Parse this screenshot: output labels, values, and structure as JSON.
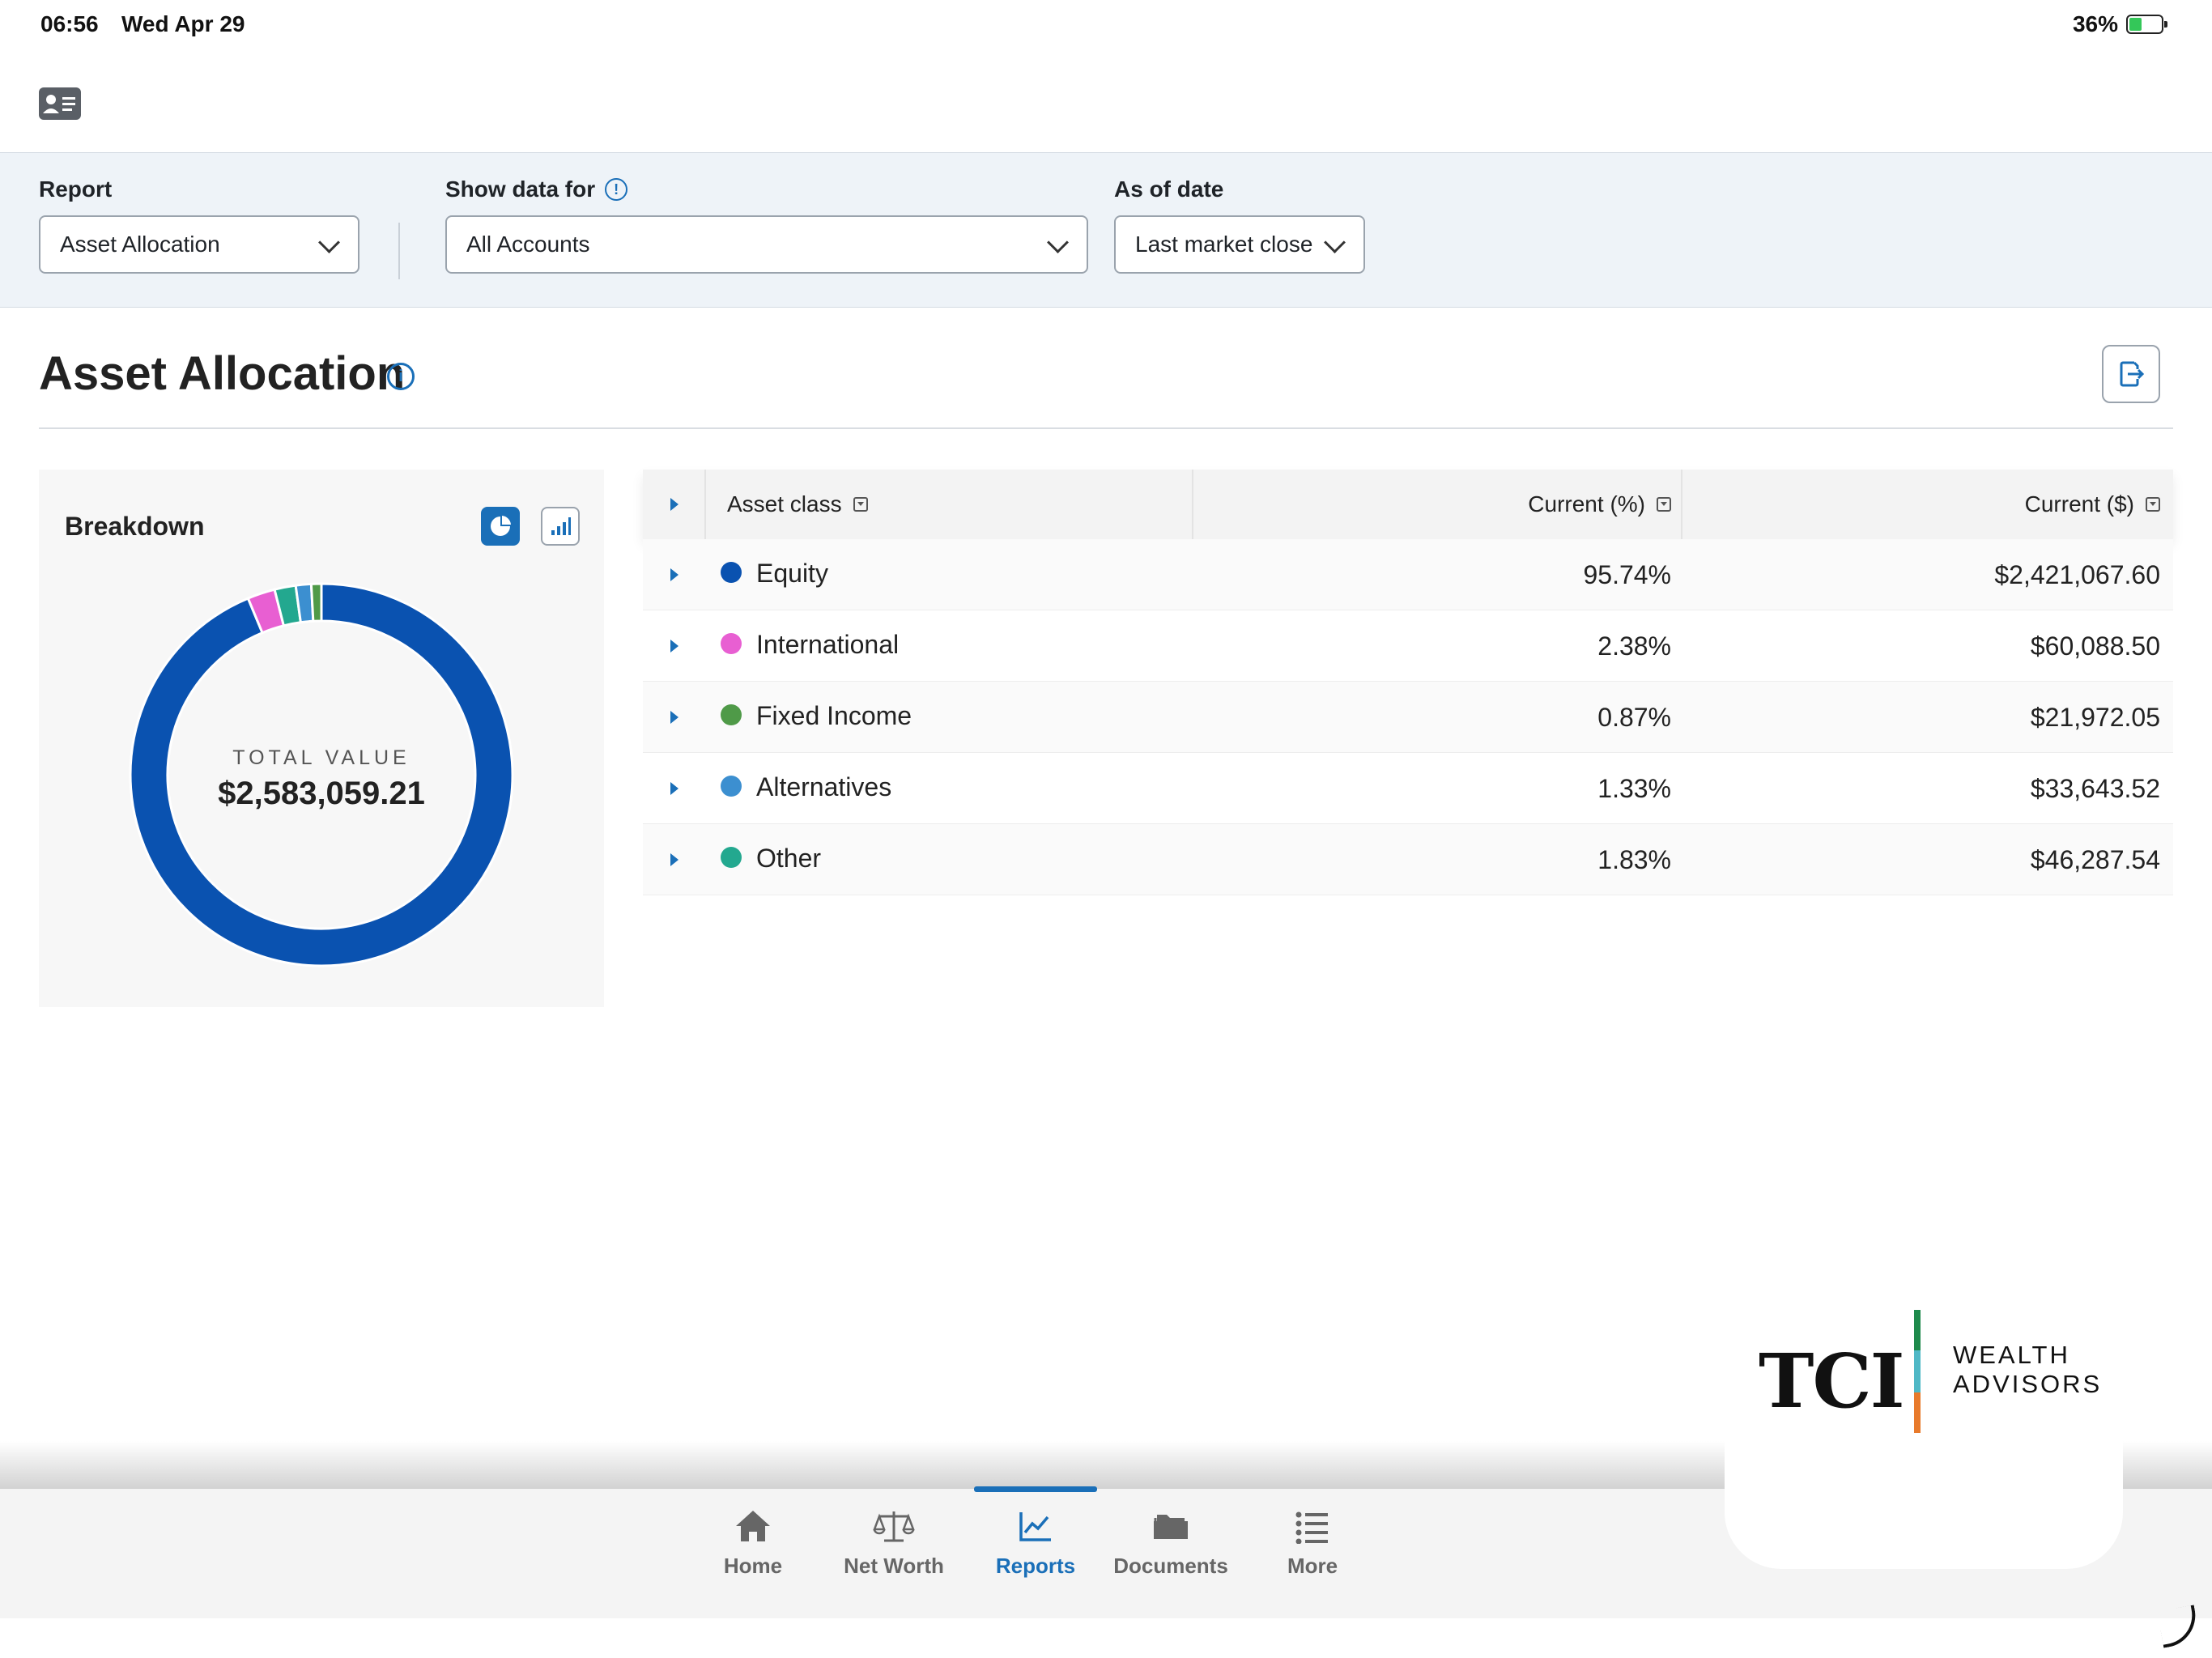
{
  "status_bar": {
    "time": "06:56",
    "date": "Wed Apr 29",
    "battery": "36%"
  },
  "filters": {
    "report_label": "Report",
    "report_value": "Asset Allocation",
    "show_data_label": "Show data for",
    "show_data_value": "All Accounts",
    "as_of_label": "As of date",
    "as_of_value": "Last market close"
  },
  "page": {
    "title": "Asset Allocation"
  },
  "breakdown": {
    "title": "Breakdown",
    "total_label": "TOTAL VALUE",
    "total_value": "$2,583,059.21"
  },
  "table": {
    "headers": {
      "asset_class": "Asset class",
      "current_pct": "Current (%)",
      "current_amt": "Current ($)"
    },
    "rows": [
      {
        "name": "Equity",
        "pct": "95.74%",
        "amt": "$2,421,067.60",
        "color": "#0a52b0"
      },
      {
        "name": "International",
        "pct": "2.38%",
        "amt": "$60,088.50",
        "color": "#e85fd2"
      },
      {
        "name": "Fixed Income",
        "pct": "0.87%",
        "amt": "$21,972.05",
        "color": "#4f9a48"
      },
      {
        "name": "Alternatives",
        "pct": "1.33%",
        "amt": "$33,643.52",
        "color": "#3c8fd0"
      },
      {
        "name": "Other",
        "pct": "1.83%",
        "amt": "$46,287.54",
        "color": "#23a88f"
      }
    ]
  },
  "nav": {
    "items": [
      {
        "label": "Home",
        "icon": "home-icon"
      },
      {
        "label": "Net Worth",
        "icon": "scale-icon"
      },
      {
        "label": "Reports",
        "icon": "chart-line-icon"
      },
      {
        "label": "Documents",
        "icon": "folder-icon"
      },
      {
        "label": "More",
        "icon": "list-icon"
      }
    ],
    "active": "Reports"
  },
  "logo": {
    "mark": "TCI",
    "line1": "WEALTH",
    "line2": "ADVISORS"
  },
  "colors": {
    "accent": "#1a6fb8",
    "filter_bg": "#eef3f8"
  }
}
